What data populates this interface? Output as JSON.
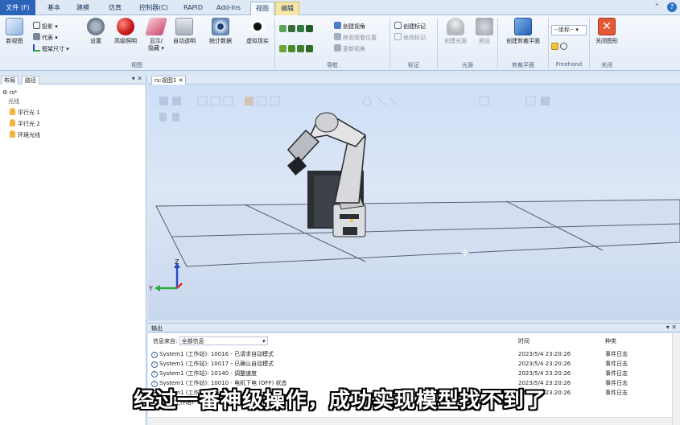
{
  "tabs": [
    {
      "label": "文件 (F)"
    },
    {
      "label": "基本"
    },
    {
      "label": "建模"
    },
    {
      "label": "仿真"
    },
    {
      "label": "控制器(C)"
    },
    {
      "label": "RAPID"
    },
    {
      "label": "Add-Ins"
    },
    {
      "label": "视图"
    },
    {
      "label": "编辑"
    }
  ],
  "ribbon": {
    "new_view": "新视图",
    "projection": "投影",
    "proxy": "代表",
    "frame_size": "框架尺寸",
    "settings": "设置",
    "advanced_lighting": "高级照明",
    "show_hide_1": "显示/",
    "show_hide_2": "隐藏",
    "auto_transparent": "自动透明",
    "stats": "统计数据",
    "virtual_display": "虚拟现实",
    "group_view": "视图",
    "create_viewpoint": "创建视角",
    "move_to_viewpoint": "移到观看位置",
    "update_viewpoint": "更新视角",
    "group_nav": "导航",
    "create_marker": "创建标记",
    "modify_marker": "修改标记",
    "group_marker": "标记",
    "create_light": "创建光源",
    "preset": "预设",
    "group_light": "光源",
    "create_clip_plane": "创建剪裁平面",
    "group_clip": "剪裁平面",
    "coord_select": "--坐标--",
    "group_freehand": "Freehand",
    "close_graphics": "关闭图形",
    "group_close": "关闭"
  },
  "left_panel": {
    "tab_layout": "布局",
    "tab_paths": "路径",
    "station": "rs*",
    "lights_header": "光线",
    "lights": [
      "平行光 1",
      "平行光 2",
      "环境光线"
    ]
  },
  "viewport": {
    "tab_label": "rs:视图1"
  },
  "output": {
    "title": "输出",
    "filter_label": "信息来自:",
    "filter_value": "全部信息",
    "col_time": "时间",
    "col_type": "种类",
    "rows": [
      {
        "msg": "System1 (工作站): 10016 - 已请求自动模式",
        "time": "2023/5/4 23:20:26",
        "type": "事件日志"
      },
      {
        "msg": "System1 (工作站): 10017 - 已确认自动模式",
        "time": "2023/5/4 23:20:26",
        "type": "事件日志"
      },
      {
        "msg": "System1 (工作站): 10140 - 调整速度",
        "time": "2023/5/4 23:20:26",
        "type": "事件日志"
      },
      {
        "msg": "System1 (工作站): 10010 - 电机下电 (OFF) 状态",
        "time": "2023/5/4 23:20:26",
        "type": "事件日志"
      },
      {
        "msg": "System1 (工作站): ...",
        "time": "2023/5/4 23:20:26",
        "type": "事件日志"
      },
      {
        "msg": "已... (工作站)",
        "time": "",
        "type": ""
      }
    ]
  },
  "subtitle": "经过一番神级操作，成功实现模型找不到了",
  "colors": {
    "file_tab": "#2c64b9",
    "edit_tab": "#f6e7a7",
    "viewport_bg": "#d5e2f6",
    "axis_x": "#d62b2b",
    "axis_y": "#2ba83a",
    "axis_z": "#2b48c9"
  },
  "axes": {
    "y_label": "Y",
    "z_label": "Z"
  }
}
